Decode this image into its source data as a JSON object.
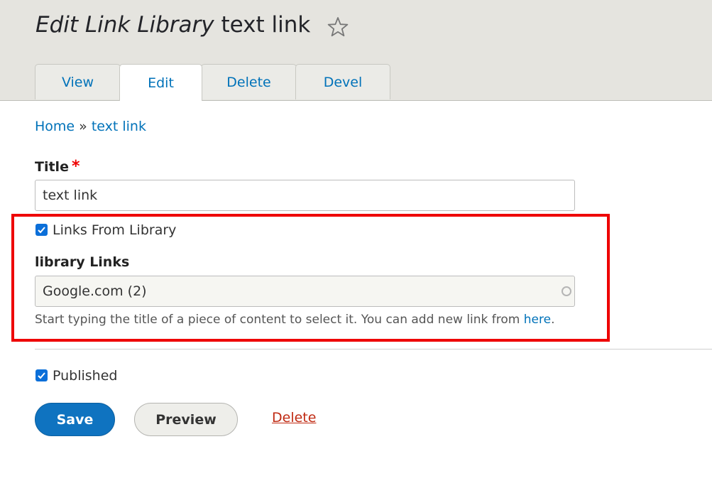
{
  "header": {
    "title_italic": "Edit Link Library",
    "title_rest": "text link"
  },
  "tabs": [
    {
      "label": "View",
      "active": false
    },
    {
      "label": "Edit",
      "active": true
    },
    {
      "label": "Delete",
      "active": false
    },
    {
      "label": "Devel",
      "active": false
    }
  ],
  "breadcrumb": {
    "home": "Home",
    "separator": "»",
    "current": "text link"
  },
  "form": {
    "title_label": "Title",
    "required_mark": "*",
    "title_value": "text link",
    "links_from_library": {
      "label": "Links From Library",
      "checked": true
    },
    "library_links": {
      "label": "library Links",
      "value": "Google.com (2)",
      "description_text": "Start typing the title of a piece of content to select it. You can add new link from ",
      "description_link": "here",
      "description_end": "."
    },
    "published": {
      "label": "Published",
      "checked": true
    }
  },
  "actions": {
    "save": "Save",
    "preview": "Preview",
    "delete": "Delete"
  },
  "colors": {
    "link": "#0072b9",
    "primary_button": "#0f73c0",
    "highlight": "#ee0000",
    "delete_link": "#c02a12"
  },
  "icons": {
    "favorite": "star-outline-icon",
    "autocomplete": "throbber-icon",
    "checkbox": "checkmark-icon"
  }
}
